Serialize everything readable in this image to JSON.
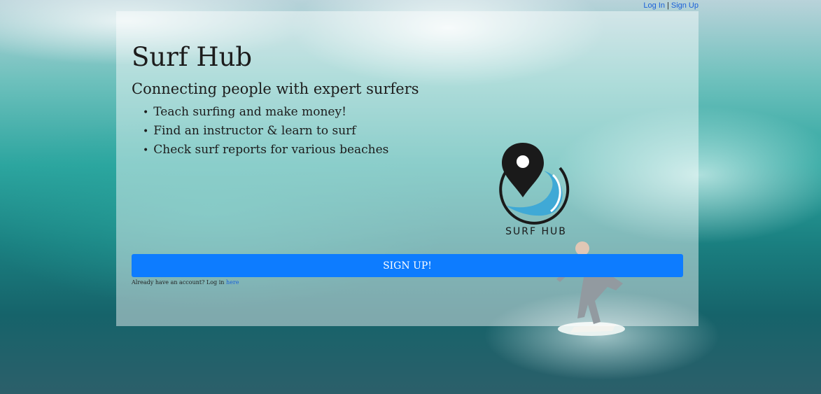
{
  "header": {
    "login_link": "Log In",
    "separator": "|",
    "signup_link": "Sign Up"
  },
  "hero": {
    "title": "Surf Hub",
    "subtitle": "Connecting people with expert surfers",
    "features": [
      "Teach surfing and make money!",
      "Find an instructor & learn to surf",
      "Check surf reports for various beaches"
    ]
  },
  "logo": {
    "text": "SURF HUB",
    "icon": "map-pin-wave-icon"
  },
  "cta": {
    "signup_button": "SIGN UP!",
    "login_prompt": "Already have an account? Log in",
    "login_here": "here"
  },
  "colors": {
    "button": "#0d7cff",
    "link": "#1a60d8",
    "logo_wave": "#3fa9d6"
  }
}
